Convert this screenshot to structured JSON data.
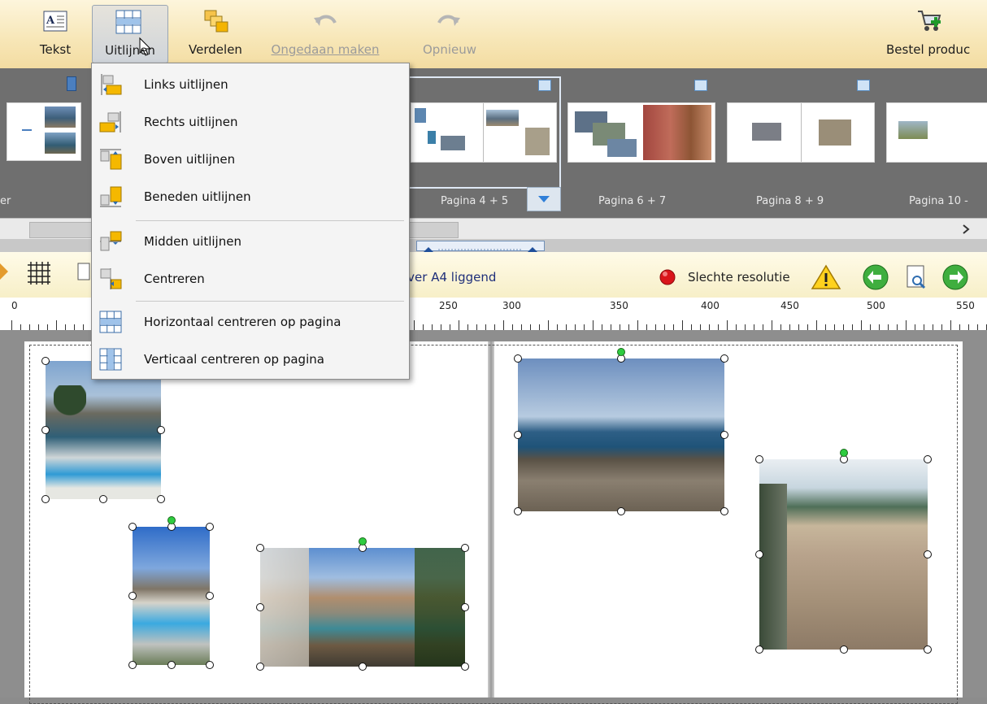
{
  "toolbar": {
    "text_label": "Tekst",
    "align_label": "Uitlijnen",
    "distribute_label": "Verdelen",
    "undo_label": "Ongedaan maken",
    "redo_label": "Opnieuw",
    "order_label": "Bestel produc"
  },
  "strip": {
    "pages": [
      {
        "label": "er"
      },
      {
        "label": "Pagina 4 + 5"
      },
      {
        "label": "Pagina 6 + 7"
      },
      {
        "label": "Pagina 8 + 9"
      },
      {
        "label": "Pagina 10 -"
      }
    ]
  },
  "toolbar2": {
    "format_text": "over A4 liggend",
    "resolution_text": "Slechte resolutie",
    "status_color": "#d9151b"
  },
  "ruler": {
    "labels": [
      "0",
      "250",
      "300",
      "350",
      "400",
      "450",
      "500",
      "550"
    ]
  },
  "menu": {
    "items": [
      {
        "label": "Links uitlijnen",
        "icon": "align-left-icon"
      },
      {
        "label": "Rechts uitlijnen",
        "icon": "align-right-icon"
      },
      {
        "label": "Boven uitlijnen",
        "icon": "align-top-icon"
      },
      {
        "label": "Beneden uitlijnen",
        "icon": "align-bottom-icon"
      },
      {
        "label": "Midden uitlijnen",
        "icon": "align-middle-icon"
      },
      {
        "label": "Centreren",
        "icon": "align-center-icon"
      },
      {
        "label": "Horizontaal centreren op pagina",
        "icon": "center-horizontal-page-icon"
      },
      {
        "label": "Verticaal centreren op pagina",
        "icon": "center-vertical-page-icon"
      }
    ]
  },
  "colors": {
    "accent": "#f5b800",
    "selection_handle": "#2ecc40",
    "ribbon": "#f7e6b6"
  }
}
